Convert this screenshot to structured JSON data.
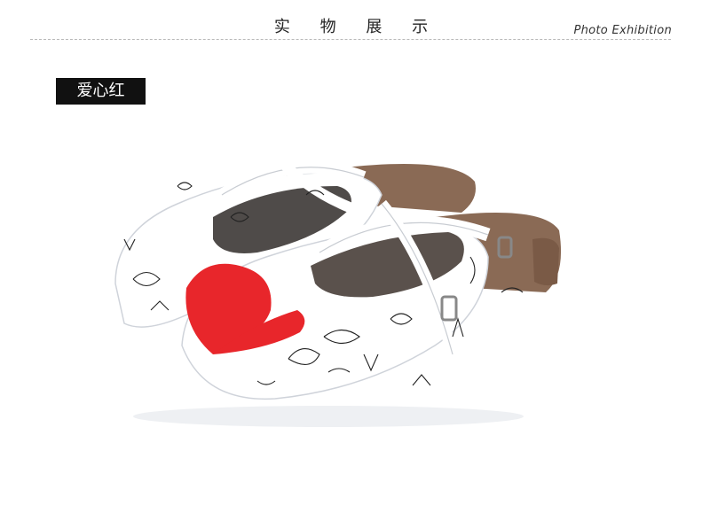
{
  "header": {
    "title": "实 物 展 示",
    "subtitle": "Photo Exhibition"
  },
  "variant": {
    "label": "爱心红"
  },
  "product_photo": {
    "subject": "pair-of-white-clogs-with-red-heart-print",
    "accent_color": "#e8262b",
    "sole_color": "#8a6a55"
  }
}
